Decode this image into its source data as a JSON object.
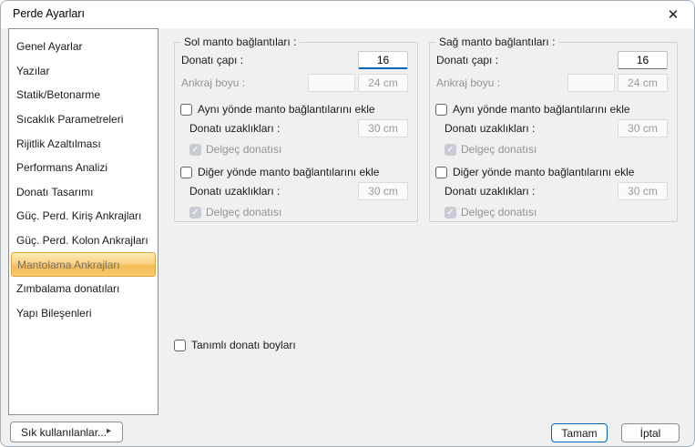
{
  "window": {
    "title": "Perde Ayarları"
  },
  "icons": {
    "close": "✕",
    "check": "✓",
    "menu_arrow": "▸"
  },
  "colors": {
    "accent": "#0067c0",
    "selected_item_border": "#e0a23c",
    "selected_item_bg_top": "#fdeab3",
    "selected_item_bg_bottom": "#f6c968"
  },
  "sidebar": {
    "items": [
      {
        "label": "Genel Ayarlar",
        "selected": false
      },
      {
        "label": "Yazılar",
        "selected": false
      },
      {
        "label": "Statik/Betonarme",
        "selected": false
      },
      {
        "label": "Sıcaklık Parametreleri",
        "selected": false
      },
      {
        "label": "Rijitlik Azaltılması",
        "selected": false
      },
      {
        "label": "Performans Analizi",
        "selected": false
      },
      {
        "label": "Donatı Tasarımı",
        "selected": false
      },
      {
        "label": "Güç. Perd. Kiriş Ankrajları",
        "selected": false
      },
      {
        "label": "Güç. Perd. Kolon Ankrajları",
        "selected": false
      },
      {
        "label": "Mantolama Ankrajları",
        "selected": true
      },
      {
        "label": "Zımbalama donatıları",
        "selected": false
      },
      {
        "label": "Yapı Bileşenleri",
        "selected": false
      }
    ]
  },
  "panels": [
    {
      "title": "Sol manto bağlantıları :",
      "diameter_label": "Donatı çapı :",
      "diameter_value": "16",
      "diameter_focused": true,
      "anchor_label": "Ankraj boyu :",
      "anchor_extra_value": "",
      "anchor_value": "24 cm",
      "same_dir_label": "Aynı yönde manto bağlantılarını ekle",
      "same_dir_checked": false,
      "spacing1_label": "Donatı uzaklıkları :",
      "spacing1_value": "30 cm",
      "punch1_label": "Delgeç donatısı",
      "punch1_checked": true,
      "other_dir_label": "Diğer yönde manto bağlantılarını ekle",
      "other_dir_checked": false,
      "spacing2_label": "Donatı uzaklıkları :",
      "spacing2_value": "30 cm",
      "punch2_label": "Delgeç donatısı",
      "punch2_checked": true
    },
    {
      "title": "Sağ manto bağlantıları :",
      "diameter_label": "Donatı çapı :",
      "diameter_value": "16",
      "diameter_focused": false,
      "anchor_label": "Ankraj boyu :",
      "anchor_extra_value": "",
      "anchor_value": "24 cm",
      "same_dir_label": "Aynı yönde manto bağlantılarını ekle",
      "same_dir_checked": false,
      "spacing1_label": "Donatı uzaklıkları :",
      "spacing1_value": "30 cm",
      "punch1_label": "Delgeç donatısı",
      "punch1_checked": true,
      "other_dir_label": "Diğer yönde manto bağlantılarını ekle",
      "other_dir_checked": false,
      "spacing2_label": "Donatı uzaklıkları :",
      "spacing2_value": "30 cm",
      "punch2_label": "Delgeç donatısı",
      "punch2_checked": true
    }
  ],
  "extras": {
    "defined_lengths_label": "Tanımlı donatı boyları",
    "defined_lengths_checked": false
  },
  "footer": {
    "favorites_label": "Sık kullanılanlar...",
    "ok_label": "Tamam",
    "cancel_label": "İptal"
  }
}
